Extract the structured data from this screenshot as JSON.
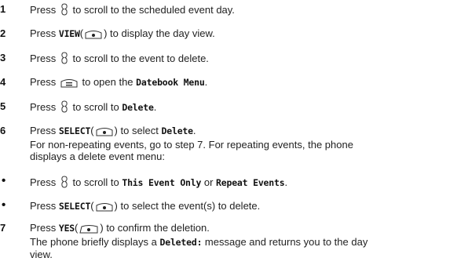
{
  "steps": [
    {
      "num": "1",
      "parts": [
        "Press",
        "to scroll to the scheduled event day."
      ]
    },
    {
      "num": "2",
      "parts": [
        "Press",
        "VIEW",
        "(",
        ") to display the day view."
      ]
    },
    {
      "num": "3",
      "parts": [
        "Press",
        "to scroll to the event to delete."
      ]
    },
    {
      "num": "4",
      "parts": [
        "Press",
        "to open the",
        "Datebook Menu",
        "."
      ]
    },
    {
      "num": "5",
      "parts": [
        "Press",
        "to scroll to",
        "Delete",
        "."
      ]
    },
    {
      "num": "6",
      "parts": [
        "Press",
        "SELECT",
        "(",
        ") to select",
        "Delete",
        "."
      ],
      "lines": [
        "For non-repeating events, go to step 7. For repeating events, the phone",
        "displays a delete event menu:"
      ]
    },
    {
      "num": "•",
      "parts": [
        "Press",
        "to scroll to",
        "This Event Only",
        "or",
        "Repeat Events",
        "."
      ]
    },
    {
      "num": "•",
      "parts": [
        "Press",
        "SELECT",
        "(",
        ") to select the event(s) to delete."
      ]
    },
    {
      "num": "7",
      "parts": [
        "Press",
        "YES",
        "(",
        ") to confirm the deletion."
      ],
      "lines": [
        "The phone briefly displays a",
        "Deleted:",
        "message and returns you to the day",
        "view."
      ]
    }
  ],
  "icons": {
    "nav": "nav-key-icon",
    "center": "center-select-key-icon",
    "menu": "menu-key-icon",
    "softkey": "left-softkey-icon"
  }
}
